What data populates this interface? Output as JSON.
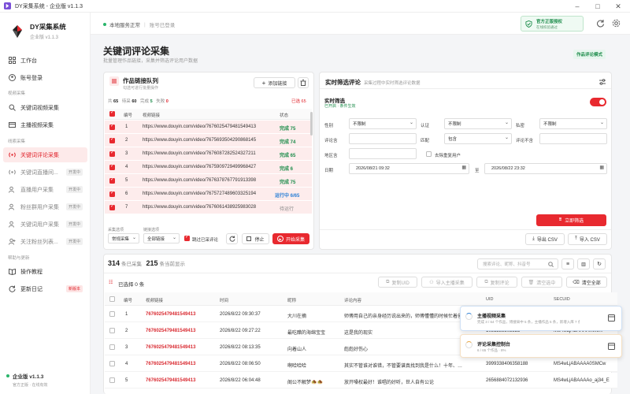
{
  "window": {
    "title": "DY采集系统 - 企业版 v1.1.3"
  },
  "sidebar": {
    "brand_name": "DY采集系统",
    "brand_edition": "企业版 v1.1.3",
    "items": [
      {
        "label": "工作台",
        "section": ""
      },
      {
        "label": "账号登录",
        "section": ""
      },
      {
        "label": "关键词视频采集",
        "section": "视频采集"
      },
      {
        "label": "主播视频采集",
        "section": ""
      },
      {
        "label": "关键词评论采集",
        "section": "线索采集"
      },
      {
        "label": "关键词直播间...",
        "badge": "开发中"
      },
      {
        "label": "直播用户采集",
        "badge": "开发中"
      },
      {
        "label": "粉丝群用户采集",
        "badge": "开发中"
      },
      {
        "label": "关键词用户采集",
        "badge": "开发中"
      },
      {
        "label": "关注粉丝列表...",
        "badge": "开发中"
      },
      {
        "label": "操作教程",
        "section": "帮助与更新"
      },
      {
        "label": "更新日记",
        "badge": "新版本"
      }
    ],
    "sections": {
      "video": "视频采集",
      "lead": "线索采集",
      "help": "帮助与更新"
    },
    "footer_edition": "企业版 v1.1.3",
    "footer_sub": "官方正版 · 在线有效"
  },
  "topbar": {
    "service_status": "本地服务正常",
    "account_status": "账号已登录",
    "license_title": "官方正版授权",
    "license_sub": "在线校验通过"
  },
  "page": {
    "title": "关键词评论采集",
    "subtitle": "批量管理作品链接，采集并筛选评论用户数据",
    "mode_badge": "作品评论模式"
  },
  "queue": {
    "title": "作品链接队列",
    "subtitle": "勾选可进行批量操作",
    "add_label": "添加链接",
    "stats": {
      "all_label": "共",
      "all": "65",
      "wait_label": "待采",
      "wait": "60",
      "done_label": "完成",
      "done": "5",
      "fail_label": "失败",
      "fail": "0",
      "selected": "已选 65"
    },
    "headers": {
      "idx": "编号",
      "link": "视频链接",
      "status": "状态"
    },
    "rows": [
      {
        "idx": "1",
        "link": "https://www.douyin.com/video/7676025479481549413",
        "status": "完成 75",
        "kind": "done"
      },
      {
        "idx": "2",
        "link": "https://www.douyin.com/video/7675693504290868145",
        "status": "完成 74",
        "kind": "done"
      },
      {
        "idx": "3",
        "link": "https://www.douyin.com/video/7676087282524327211",
        "status": "完成 65",
        "kind": "done"
      },
      {
        "idx": "4",
        "link": "https://www.douyin.com/video/7675909729499968427",
        "status": "完成 6",
        "kind": "done"
      },
      {
        "idx": "5",
        "link": "https://www.douyin.com/video/7676378767791913398",
        "status": "完成 75",
        "kind": "done"
      },
      {
        "idx": "6",
        "link": "https://www.douyin.com/video/7675727489603325194",
        "status": "运行中 6/65",
        "kind": "run"
      },
      {
        "idx": "7",
        "link": "https://www.douyin.com/video/7676061438925983028",
        "status": "待运行",
        "kind": "wait"
      }
    ],
    "opt_mode_label": "采集选项",
    "opt_mode": "常规采集",
    "opt_link_label": "链接选项",
    "opt_link": "全部链接",
    "skip_label": "跳过已采评论",
    "stop_label": "停止",
    "start_label": "开始采集"
  },
  "filter": {
    "title": "实时筛选评论",
    "subtitle": "采集过程中实时筛选评论数据",
    "rt_title": "实时筛选",
    "rt_sub": "已开启 · 条件生效",
    "gender_label": "性别",
    "gender": "不限制",
    "verify_label": "认证",
    "verify": "不限制",
    "private_label": "私密",
    "private": "不限制",
    "comment_label": "评论含",
    "match_label": "匹配",
    "match": "包含",
    "comment_no_label": "评论不含",
    "region_label": "地区含",
    "dedupe_label": "去除重复用户",
    "date_label": "日期",
    "date_from": "2026/08/21 09:32",
    "date_to_label": "至",
    "date_to": "2026/08/22 23:32",
    "reset_label": "立即筛选",
    "export_label": "导出 CSV",
    "import_label": "导入 CSV"
  },
  "results": {
    "total": "314",
    "total_label": "条已采集",
    "shown": "215",
    "shown_label": "条当前显示",
    "search_placeholder": "搜索评论、昵称、抖音号",
    "selected_label": "已选择 0 条",
    "actions": {
      "copy_uid": "复制UID",
      "import_anchor": "导入主播采集",
      "copy_comment": "复制评论",
      "clear_selected": "清空选中",
      "clear_all": "清空全部"
    },
    "headers": {
      "idx": "编号",
      "link": "视频链接",
      "time": "时间",
      "nick": "昵称",
      "comment": "评论内容",
      "uid": "UID",
      "secuid": "SECUID"
    },
    "rows": [
      {
        "idx": "1",
        "link": "7676025479481549413",
        "time": "2026/8/22 09:30:37",
        "nick": "大川在摘",
        "comment": "师傅用自己的亲身经历说出来的，师傅懂懂的时候忙着创新",
        "uid": "",
        "secuid": ""
      },
      {
        "idx": "2",
        "link": "7676025479481549413",
        "time": "2026/8/22 09:27:22",
        "nick": "最吃醋的海绵宝宝",
        "comment": "这是我的现实",
        "uid": "1031288305325",
        "secuid": "MS4wLjABAAAAhWo..."
      },
      {
        "idx": "3",
        "link": "7676025479481549413",
        "time": "2026/8/22 08:13:35",
        "nick": "向着山人",
        "comment": "彪彪好伤心",
        "uid": "",
        "secuid": ""
      },
      {
        "idx": "4",
        "link": "7676025479481549413",
        "time": "2026/8/22 08:06:50",
        "nick": "啊哈哈哈",
        "comment": "其实不管谁对谁错，不管要谱真找到我是什么！十年、…",
        "uid": "3999338406358188",
        "secuid": "MS4wLjABAAAA0SMCw"
      },
      {
        "idx": "5",
        "link": "7676025479481549413",
        "time": "2026/8/22 06:04:48",
        "nick": "阁公不解梦🧆🧆",
        "comment": "放开嗓权最好！谁唱的好听，世人自有公论",
        "uid": "2656884072132936",
        "secuid": "MS4wLjABAAAAo_aj34_E"
      }
    ]
  },
  "toasts": [
    {
      "title": "主播视频采集",
      "desc": "完成 3 / 64 个作品，博搜采中 5 条，主播作品 5 条，新增入库 7 条"
    },
    {
      "title": "评论采集控制台",
      "desc": "6 / 65 个作品 · 8%"
    }
  ],
  "colors": {
    "accent": "#e8292f",
    "success": "#1c8c4a",
    "running": "#2a7fd6"
  }
}
